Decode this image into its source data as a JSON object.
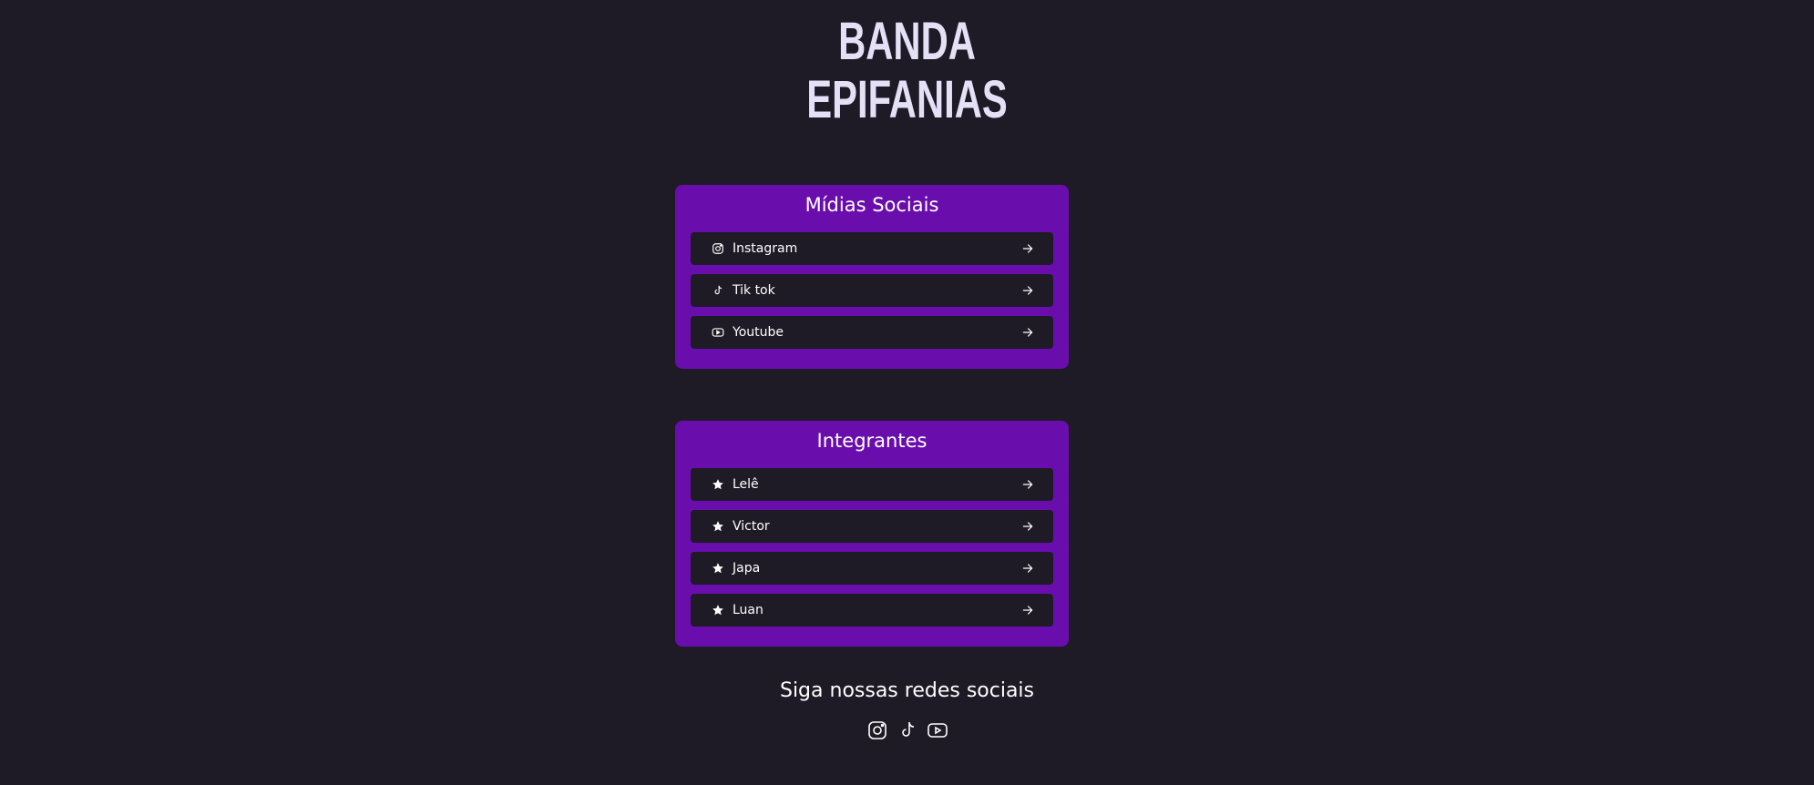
{
  "header": {
    "title_line1": "BANDA",
    "title_line2": "EPIFANIAS"
  },
  "colors": {
    "background": "#1e1b26",
    "card": "#6a0dad",
    "title": "#e4e1f7",
    "row": "#1e1b26"
  },
  "social_card": {
    "title": "Mídias Sociais",
    "items": [
      {
        "label": "Instagram",
        "icon": "instagram-icon"
      },
      {
        "label": "Tik tok",
        "icon": "tiktok-icon"
      },
      {
        "label": "Youtube",
        "icon": "youtube-icon"
      }
    ]
  },
  "members_card": {
    "title": "Integrantes",
    "items": [
      {
        "label": "Lelê",
        "icon": "star-icon"
      },
      {
        "label": "Victor",
        "icon": "star-icon"
      },
      {
        "label": "Japa",
        "icon": "star-icon"
      },
      {
        "label": "Luan",
        "icon": "star-icon"
      }
    ]
  },
  "footer": {
    "title": "Siga nossas redes sociais",
    "icons": [
      "instagram-icon",
      "tiktok-icon",
      "youtube-icon"
    ]
  }
}
